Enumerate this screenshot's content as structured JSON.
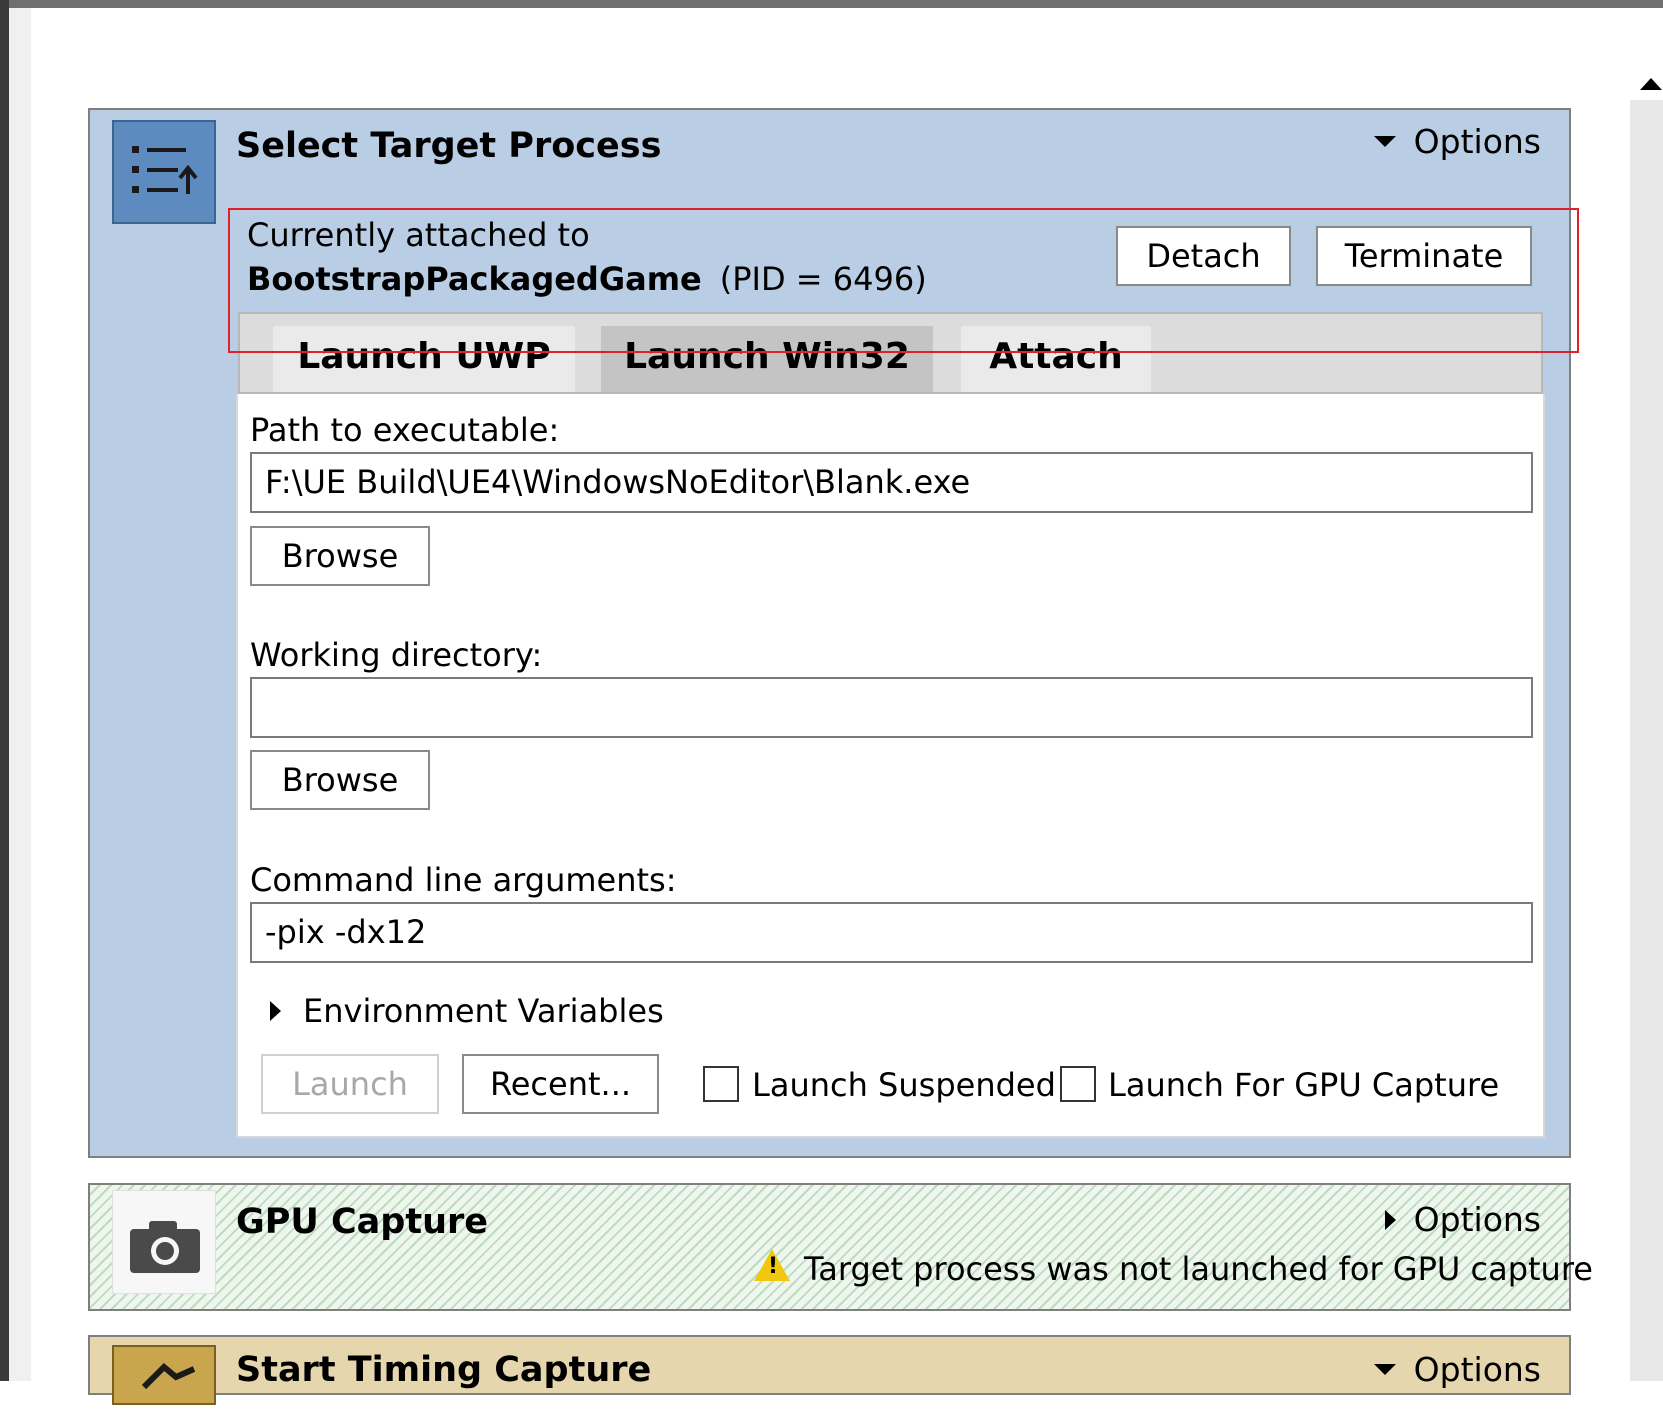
{
  "select_target": {
    "title": "Select Target Process",
    "options_label": "Options",
    "icon": "target-list-icon",
    "attached_prefix": "Currently attached to",
    "process_name": "BootstrapPackagedGame",
    "pid_text": "(PID = 6496)",
    "detach_label": "Detach",
    "terminate_label": "Terminate",
    "tabs": [
      {
        "label": "Launch UWP",
        "selected": false
      },
      {
        "label": "Launch Win32",
        "selected": true
      },
      {
        "label": "Attach",
        "selected": false
      }
    ],
    "path_label": "Path to executable:",
    "path_value": "F:\\UE Build\\UE4\\WindowsNoEditor\\Blank.exe",
    "browse_label": "Browse",
    "working_dir_label": "Working directory:",
    "working_dir_value": "",
    "cmd_label": "Command line arguments:",
    "cmd_value": "-pix -dx12",
    "env_vars_label": "Environment Variables",
    "launch_label": "Launch",
    "recent_label": "Recent...",
    "launch_suspended_label": "Launch Suspended",
    "launch_gpu_label": "Launch For GPU Capture",
    "launch_suspended_checked": false,
    "launch_gpu_checked": false
  },
  "gpu_capture": {
    "title": "GPU Capture",
    "options_label": "Options",
    "icon": "camera-icon",
    "warning": "Target process was not launched for GPU capture"
  },
  "timing_capture": {
    "title": "Start Timing Capture",
    "options_label": "Options",
    "icon": "timing-icon"
  },
  "colors": {
    "select_panel": "#b9cde4",
    "select_icon": "#5d8bc0",
    "timing_panel": "#e6d6ad",
    "highlight": "#e0202a",
    "warning": "#f2c80f"
  }
}
